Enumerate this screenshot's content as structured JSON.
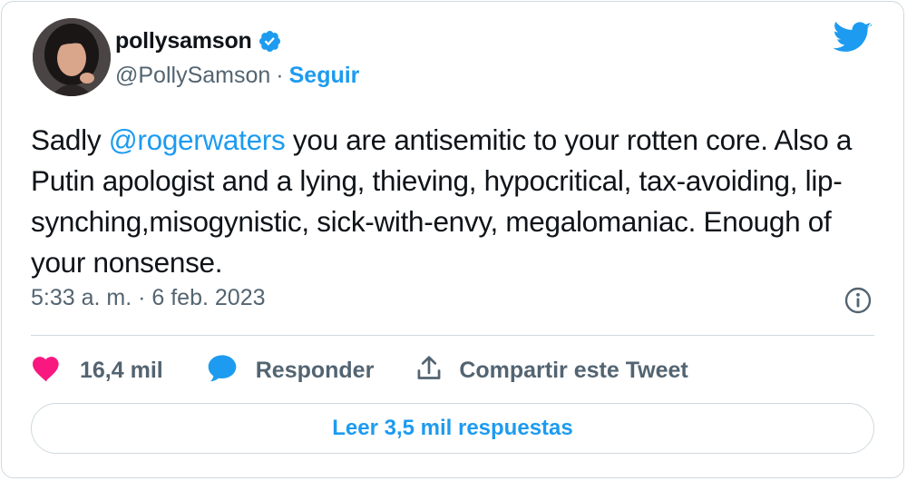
{
  "author": {
    "display_name": "pollysamson",
    "handle": "@PollySamson",
    "separator": "·",
    "follow_label": "Seguir",
    "verified": true
  },
  "tweet": {
    "text_before": "Sadly ",
    "mention": "@rogerwaters",
    "text_after": " you are antisemitic to your rotten core. Also a Putin apologist and a lying, thieving, hypocritical, tax-avoiding, lip-synching,misogynistic, sick-with-envy, megalomaniac. Enough of your nonsense.",
    "timestamp": "5:33 a. m. · 6 feb. 2023"
  },
  "actions": {
    "likes": "16,4 mil",
    "reply_label": "Responder",
    "share_label": "Compartir este Tweet"
  },
  "read_replies_label": "Leer 3,5 mil respuestas",
  "icons": {
    "brand": "twitter-bird-icon",
    "verified": "verified-badge-icon",
    "info": "info-icon",
    "like": "heart-icon",
    "reply": "speech-bubble-icon",
    "share": "share-upload-icon"
  },
  "colors": {
    "accent": "#1d9bf0",
    "like": "#f91880",
    "text": "#0f1419",
    "secondary": "#536471",
    "border": "#cfd9de"
  }
}
